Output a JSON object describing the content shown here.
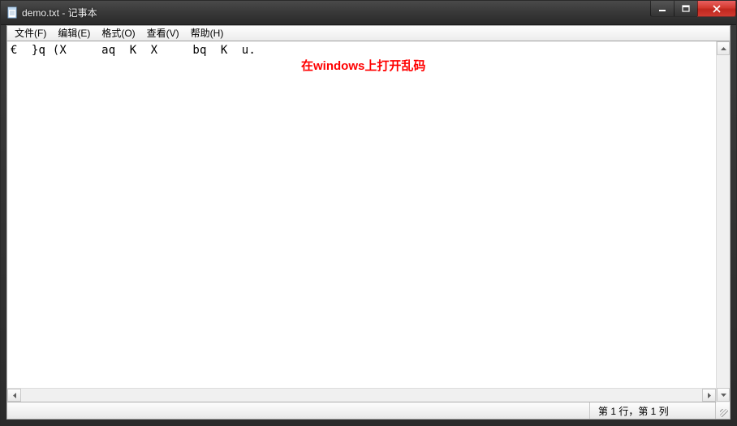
{
  "window": {
    "title": "demo.txt - 记事本"
  },
  "menu": {
    "file": "文件(F)",
    "edit": "编辑(E)",
    "format": "格式(O)",
    "view": "查看(V)",
    "help": "帮助(H)"
  },
  "content": {
    "line1": "€  }q (X     aq  K  X     bq  K  u.",
    "annotation": "在windows上打开乱码"
  },
  "status": {
    "position": "第 1 行，第 1 列"
  }
}
